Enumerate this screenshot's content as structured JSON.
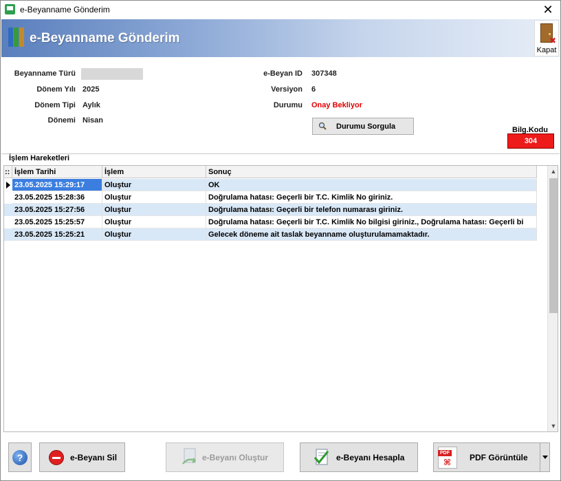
{
  "window": {
    "title": "e-Beyanname Gönderim",
    "close_symbol": "✕"
  },
  "banner": {
    "title": "e-Beyanname Gönderim",
    "close_label": "Kapat"
  },
  "info": {
    "beyanname_turu_label": "Beyanname Türü",
    "donem_yili_label": "Dönem Yılı",
    "donem_yili_value": "2025",
    "donem_tipi_label": "Dönem Tipi",
    "donem_tipi_value": "Aylık",
    "donemi_label": "Dönemi",
    "donemi_value": "Nisan",
    "ebeyan_id_label": "e-Beyan ID",
    "ebeyan_id_value": "307348",
    "versiyon_label": "Versiyon",
    "versiyon_value": "6",
    "durumu_label": "Durumu",
    "durumu_value": "Onay Bekliyor",
    "durumu_color": "#e00000"
  },
  "sorgula_button": "Durumu Sorgula",
  "bilg": {
    "label": "Bilg.Kodu",
    "value": "304",
    "color": "#ee1b1b"
  },
  "group_title": "İşlem Hareketleri",
  "grid": {
    "handle": "::",
    "columns": [
      "İşlem Tarihi",
      "İşlem",
      "Sonuç"
    ],
    "rows": [
      {
        "tarih": "23.05.2025 15:29:17",
        "islem": "Oluştur",
        "sonuc": "OK"
      },
      {
        "tarih": "23.05.2025 15:28:36",
        "islem": "Oluştur",
        "sonuc": "Doğrulama hatası: Geçerli bir T.C. Kimlik No giriniz."
      },
      {
        "tarih": "23.05.2025 15:27:56",
        "islem": "Oluştur",
        "sonuc": "Doğrulama hatası: Geçerli bir telefon numarası giriniz."
      },
      {
        "tarih": "23.05.2025 15:25:57",
        "islem": "Oluştur",
        "sonuc": "Doğrulama hatası: Geçerli bir T.C. Kimlik No bilgisi giriniz., Doğrulama hatası: Geçerli bi"
      },
      {
        "tarih": "23.05.2025 15:25:21",
        "islem": "Oluştur",
        "sonuc": "Gelecek döneme ait taslak beyanname oluşturulamamaktadır."
      }
    ]
  },
  "buttons": {
    "help": "?",
    "sil": "e-Beyanı Sil",
    "olustur": "e-Beyanı Oluştur",
    "hesapla": "e-Beyanı Hesapla",
    "pdf": "PDF Görüntüle",
    "pdf_icon_text": "PDF"
  }
}
